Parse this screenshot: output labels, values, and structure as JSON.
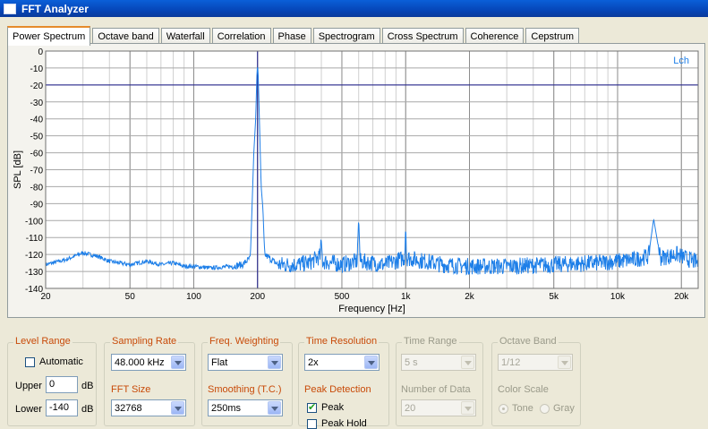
{
  "window": {
    "title": "FFT Analyzer"
  },
  "tabs": [
    {
      "label": "Power Spectrum",
      "active": true
    },
    {
      "label": "Octave band"
    },
    {
      "label": "Waterfall"
    },
    {
      "label": "Correlation"
    },
    {
      "label": "Phase"
    },
    {
      "label": "Spectrogram"
    },
    {
      "label": "Cross Spectrum"
    },
    {
      "label": "Coherence"
    },
    {
      "label": "Cepstrum"
    }
  ],
  "chart_data": {
    "type": "line",
    "xlabel": "Frequency [Hz]",
    "ylabel": "SPL [dB]",
    "xscale": "log",
    "xlim": [
      20,
      24000
    ],
    "ylim": [
      -140,
      0
    ],
    "yticks": [
      0,
      -10,
      -20,
      -30,
      -40,
      -50,
      -60,
      -70,
      -80,
      -90,
      -100,
      -110,
      -120,
      -130,
      -140
    ],
    "xticks": [
      {
        "value": 20,
        "label": "20"
      },
      {
        "value": 50,
        "label": "50"
      },
      {
        "value": 100,
        "label": "100"
      },
      {
        "value": 200,
        "label": "200"
      },
      {
        "value": 500,
        "label": "500"
      },
      {
        "value": 1000,
        "label": "1k"
      },
      {
        "value": 2000,
        "label": "2k"
      },
      {
        "value": 5000,
        "label": "5k"
      },
      {
        "value": 10000,
        "label": "10k"
      },
      {
        "value": 20000,
        "label": "20k"
      }
    ],
    "grid": true,
    "legend": "top-right",
    "cursor": {
      "frequency": 200,
      "level": -20
    },
    "series": [
      {
        "name": "Lch",
        "color": "#1e7fe8",
        "points": [
          [
            20,
            -126
          ],
          [
            25,
            -123
          ],
          [
            30,
            -119
          ],
          [
            35,
            -121
          ],
          [
            40,
            -124
          ],
          [
            50,
            -126
          ],
          [
            60,
            -124
          ],
          [
            70,
            -126
          ],
          [
            80,
            -125
          ],
          [
            90,
            -127
          ],
          [
            100,
            -127
          ],
          [
            120,
            -128
          ],
          [
            150,
            -127
          ],
          [
            170,
            -126
          ],
          [
            185,
            -122
          ],
          [
            192,
            -60
          ],
          [
            196,
            -40
          ],
          [
            199,
            -10
          ],
          [
            201,
            -10
          ],
          [
            204,
            -40
          ],
          [
            208,
            -80
          ],
          [
            212,
            -93
          ],
          [
            216,
            -120
          ],
          [
            250,
            -126
          ],
          [
            300,
            -126
          ],
          [
            350,
            -125
          ],
          [
            395,
            -121
          ],
          [
            400,
            -112
          ],
          [
            405,
            -124
          ],
          [
            500,
            -126
          ],
          [
            590,
            -124
          ],
          [
            600,
            -98
          ],
          [
            610,
            -124
          ],
          [
            800,
            -126
          ],
          [
            990,
            -122
          ],
          [
            1000,
            -102
          ],
          [
            1010,
            -122
          ],
          [
            1500,
            -126
          ],
          [
            2000,
            -127
          ],
          [
            3000,
            -127
          ],
          [
            5000,
            -126
          ],
          [
            8000,
            -125
          ],
          [
            12000,
            -123
          ],
          [
            14000,
            -121
          ],
          [
            14800,
            -99
          ],
          [
            15500,
            -114
          ],
          [
            16000,
            -122
          ],
          [
            19000,
            -120
          ],
          [
            24000,
            -125
          ]
        ]
      }
    ]
  },
  "controls": {
    "level_range": {
      "label": "Level Range",
      "automatic_label": "Automatic",
      "automatic": false,
      "upper_label": "Upper",
      "upper_value": "0",
      "upper_unit": "dB",
      "lower_label": "Lower",
      "lower_value": "-140",
      "lower_unit": "dB"
    },
    "sampling_rate": {
      "label": "Sampling Rate",
      "value": "48.000 kHz"
    },
    "fft_size": {
      "label": "FFT Size",
      "value": "32768"
    },
    "freq_weighting": {
      "label": "Freq. Weighting",
      "value": "Flat"
    },
    "smoothing": {
      "label": "Smoothing (T.C.)",
      "value": "250ms"
    },
    "time_resolution": {
      "label": "Time Resolution",
      "value": "2x"
    },
    "peak_detection": {
      "label": "Peak Detection",
      "peak_label": "Peak",
      "peak": true,
      "peak_hold_label": "Peak Hold",
      "peak_hold": false
    },
    "time_range": {
      "label": "Time Range",
      "value": "5 s"
    },
    "number_of_data": {
      "label": "Number of Data",
      "value": "20"
    },
    "octave_band": {
      "label": "Octave Band",
      "value": "1/12"
    },
    "color_scale": {
      "label": "Color Scale",
      "tone_label": "Tone",
      "gray_label": "Gray",
      "selected": "Tone"
    }
  }
}
